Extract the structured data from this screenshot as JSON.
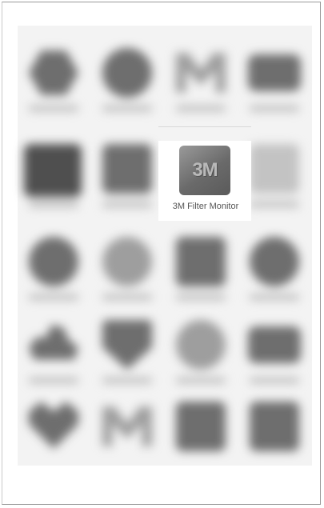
{
  "home_screen": {
    "highlighted_app": {
      "icon_text": "3M",
      "label": "3M Filter Monitor"
    },
    "blurred_apps": [
      {
        "icon": "hex"
      },
      {
        "icon": "round"
      },
      {
        "icon": "m"
      },
      {
        "icon": "wide"
      },
      {
        "icon": "dark"
      },
      {
        "icon": "mid"
      },
      {
        "icon": "highlighted"
      },
      {
        "icon": "faint"
      },
      {
        "icon": "round"
      },
      {
        "icon": "round"
      },
      {
        "icon": "sq"
      },
      {
        "icon": "round"
      },
      {
        "icon": "cloud"
      },
      {
        "icon": "shield"
      },
      {
        "icon": "round"
      },
      {
        "icon": "wide"
      },
      {
        "icon": "heart"
      },
      {
        "icon": "m"
      },
      {
        "icon": "sq"
      },
      {
        "icon": "sq"
      }
    ]
  }
}
